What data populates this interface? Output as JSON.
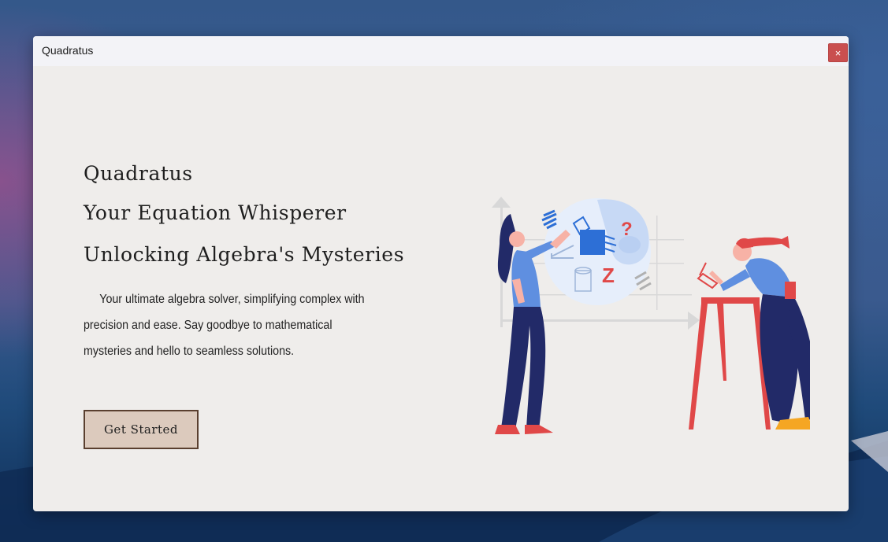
{
  "window": {
    "title": "Quadratus",
    "close_label": "×"
  },
  "hero": {
    "heading_1": "Quadratus",
    "heading_2": "Your Equation Whisperer",
    "heading_3": "Unlocking Algebra's Mysteries",
    "description": "Your ultimate algebra solver, simplifying complex with precision and ease. Say goodbye to mathematical mysteries and hello to seamless solutions.",
    "cta_label": "Get Started"
  },
  "illustration": {
    "symbol_question": "?",
    "symbol_z": "Z"
  },
  "colors": {
    "window_bg": "#efedeb",
    "titlebar_bg": "#f3f3f7",
    "close_bg": "#c94f4f",
    "button_bg": "#dccabd",
    "button_border": "#5a3f2f",
    "accent_blue": "#2d6fd6",
    "accent_red": "#e04848",
    "navy": "#222a68"
  }
}
